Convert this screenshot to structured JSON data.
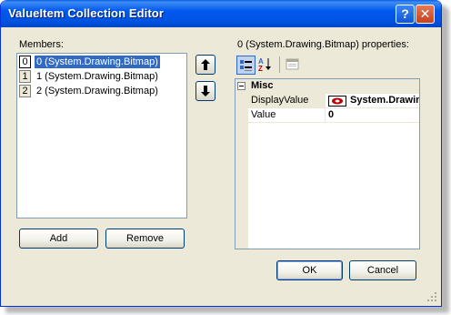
{
  "window": {
    "title": "ValueItem Collection Editor",
    "help_glyph": "?",
    "close_glyph": "✕"
  },
  "members": {
    "label": "Members:",
    "items": [
      {
        "index": "0",
        "text": "0 (System.Drawing.Bitmap)",
        "selected": true
      },
      {
        "index": "1",
        "text": "1 (System.Drawing.Bitmap)",
        "selected": false
      },
      {
        "index": "2",
        "text": "2 (System.Drawing.Bitmap)",
        "selected": false
      }
    ]
  },
  "buttons": {
    "add": "Add",
    "remove": "Remove",
    "ok": "OK",
    "cancel": "Cancel"
  },
  "properties": {
    "label": "0 (System.Drawing.Bitmap) properties:",
    "category": "Misc",
    "rows": [
      {
        "name": "DisplayValue",
        "value": "System.Drawing"
      },
      {
        "name": "Value",
        "value": "0"
      }
    ]
  },
  "icons": {
    "move_up": "arrow-up-icon",
    "move_down": "arrow-down-icon",
    "categorized": "categorized-icon",
    "alphabetical": "alphabetical-sort-icon",
    "property_pages": "property-pages-icon"
  },
  "colors": {
    "title_bar": "#0054e3",
    "selection": "#316ac5",
    "face": "#ece9d8",
    "close_button": "#c5421d"
  }
}
